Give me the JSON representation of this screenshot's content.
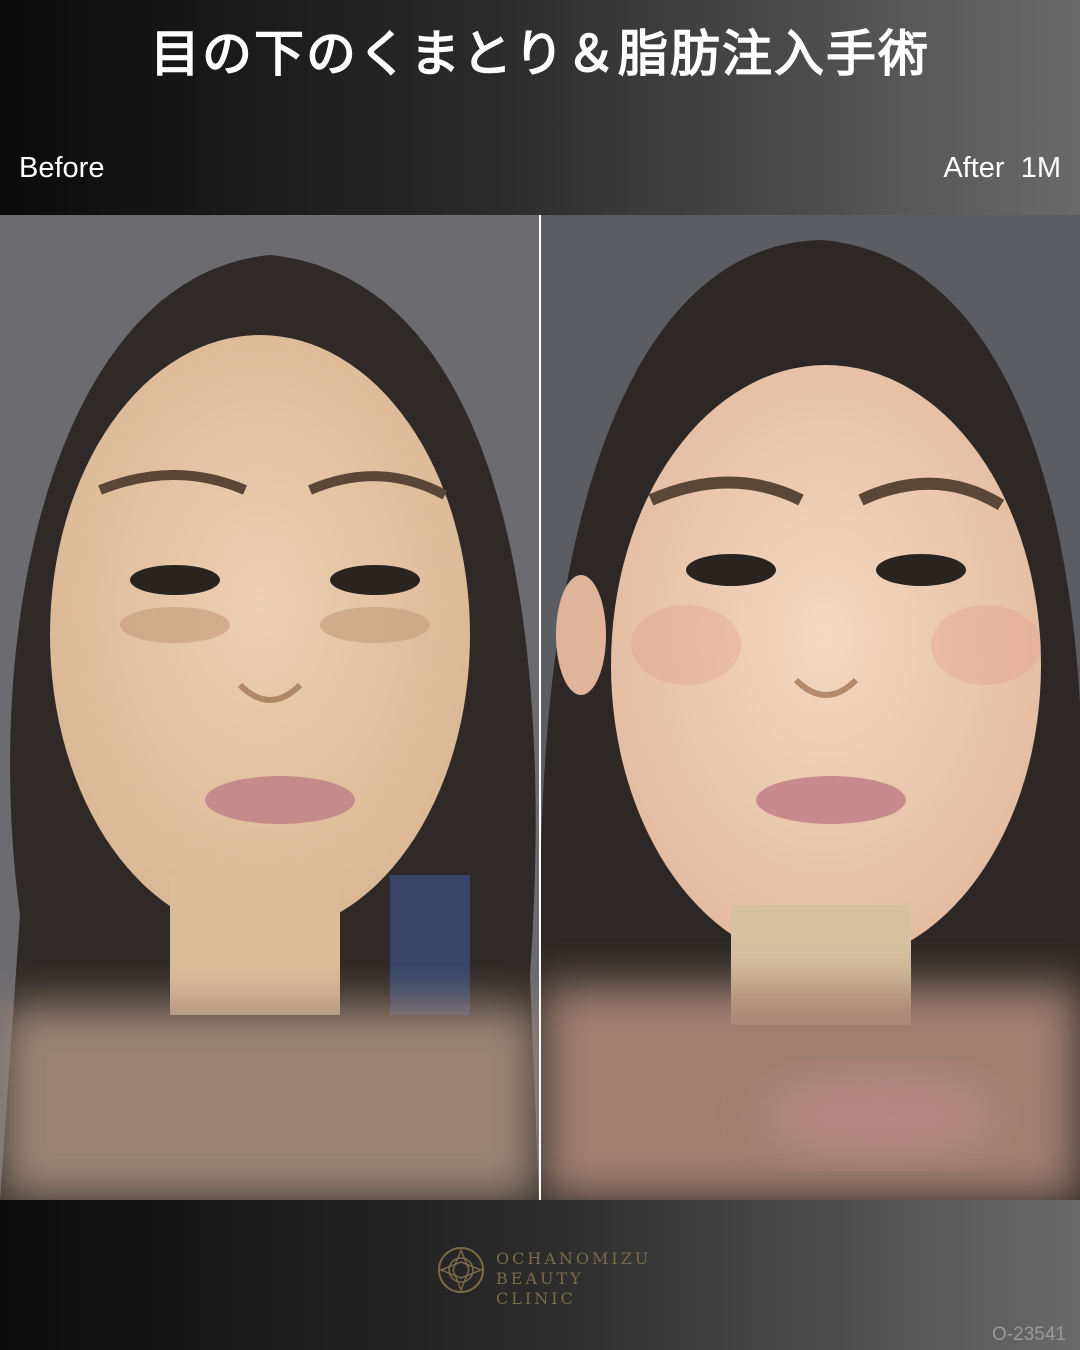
{
  "title": "目の下のくまとり＆脂肪注入手術",
  "labels": {
    "before": "Before",
    "after": "After  1M"
  },
  "logo": {
    "line1": "OCHANOMIZU",
    "line2": "BEAUTY CLINIC",
    "color": "#7a6a4a"
  },
  "case_id": "O-23541",
  "colors": {
    "skin_before": "#e6c8a8",
    "skin_after": "#efcfb5",
    "hair": "#2e2a28",
    "lips": "#c48b8b",
    "background_photo": "#6a6a6e"
  }
}
